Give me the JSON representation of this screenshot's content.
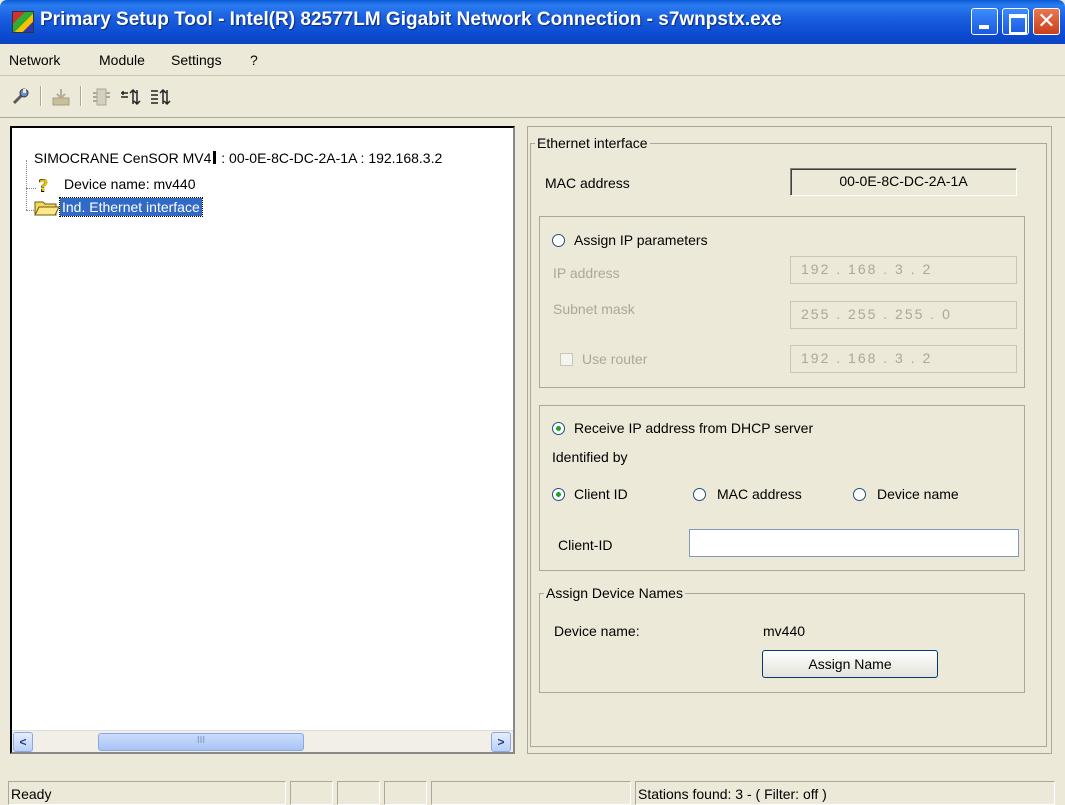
{
  "window": {
    "title": "Primary Setup Tool - Intel(R) 82577LM Gigabit Network Connection - s7wnpstx.exe",
    "close_glyph": "✕"
  },
  "menu": [
    "Network",
    "Module",
    "Settings",
    "?"
  ],
  "toolbar": {
    "icons": [
      "wrench-icon",
      "download-icon",
      "module-icon",
      "list-sort-icon",
      "list-sort-all-icon"
    ]
  },
  "tree": {
    "root_label": "SIMOCRANE CenSOR MV4",
    "root_suffix": " : 00-0E-8C-DC-2A-1A : 192.168.3.2",
    "device_name": "Device name: mv440",
    "ethernet_interface": "Ind. Ethernet interface",
    "scroll_mark": "III",
    "scroll_left": "<",
    "scroll_right": ">"
  },
  "ethernet": {
    "legend": "Ethernet interface",
    "mac_label": "MAC address",
    "mac_value": "00-0E-8C-DC-2A-1A",
    "assign_ip_label": "Assign IP parameters",
    "ip_label": "IP address",
    "ip_value": "192 . 168 .  3  .  2",
    "subnet_label": "Subnet mask",
    "subnet_value": "255 . 255 . 255 .  0",
    "router_label": "Use router",
    "router_value": "192 . 168 .  3  .  2",
    "dhcp_label": "Receive IP address from DHCP server",
    "identified_label": "Identified by",
    "client_id_option": "Client ID",
    "mac_option": "MAC address",
    "device_name_option": "Device name",
    "client_id_field_label": "Client-ID",
    "client_id_value": ""
  },
  "assign_names": {
    "legend": "Assign Device Names",
    "device_name_label": "Device name:",
    "device_name_value": "mv440",
    "button_label": "Assign Name"
  },
  "status": {
    "ready": "Ready",
    "stations": "Stations found: 3 - ( Filter: off )"
  }
}
